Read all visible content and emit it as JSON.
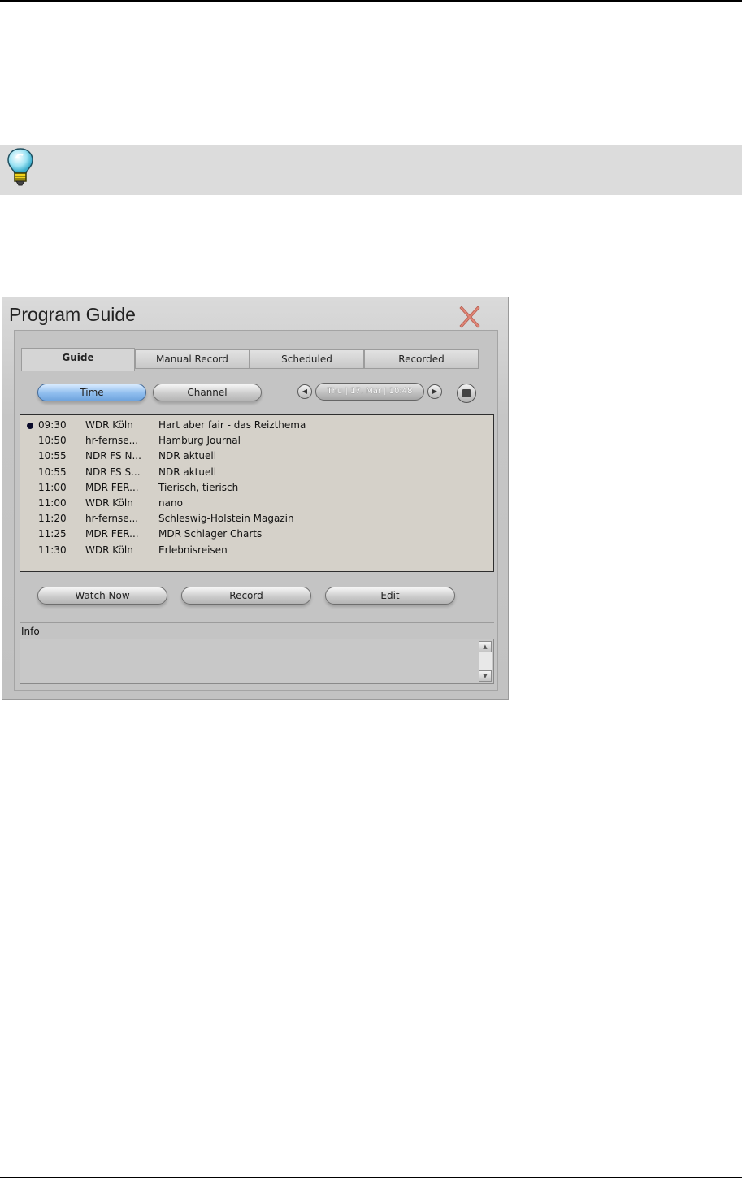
{
  "window": {
    "title": "Program Guide",
    "close_icon": "close-x-icon"
  },
  "tabs": [
    {
      "label": "Guide",
      "active": true
    },
    {
      "label": "Manual Record",
      "active": false
    },
    {
      "label": "Scheduled",
      "active": false
    },
    {
      "label": "Recorded",
      "active": false
    }
  ],
  "sort": {
    "time_label": "Time",
    "channel_label": "Channel",
    "selected": "Time"
  },
  "date": {
    "value": "Thu | 17. Mar | 10:48",
    "prev_icon": "left-arrow-icon",
    "next_icon": "right-arrow-icon",
    "calendar_icon": "calendar-icon"
  },
  "programs": [
    {
      "time": "09:30",
      "channel": "WDR Köln",
      "title": "Hart aber fair - das Reizthema",
      "current": true
    },
    {
      "time": "10:50",
      "channel": "hr-fernse...",
      "title": "Hamburg Journal",
      "current": false
    },
    {
      "time": "10:55",
      "channel": "NDR FS N...",
      "title": "NDR aktuell",
      "current": false
    },
    {
      "time": "10:55",
      "channel": "NDR FS S...",
      "title": "NDR aktuell",
      "current": false
    },
    {
      "time": "11:00",
      "channel": "MDR FER...",
      "title": "Tierisch, tierisch",
      "current": false
    },
    {
      "time": "11:00",
      "channel": "WDR Köln",
      "title": "nano",
      "current": false
    },
    {
      "time": "11:20",
      "channel": "hr-fernse...",
      "title": "Schleswig-Holstein Magazin",
      "current": false
    },
    {
      "time": "11:25",
      "channel": "MDR FER...",
      "title": "MDR Schlager Charts",
      "current": false
    },
    {
      "time": "11:30",
      "channel": "WDR Köln",
      "title": "Erlebnisreisen",
      "current": false
    }
  ],
  "actions": {
    "watch_now": "Watch Now",
    "record": "Record",
    "edit": "Edit"
  },
  "info": {
    "label": "Info"
  },
  "colors": {
    "selected_button": "#8fbdee",
    "list_background": "#d5d1c9",
    "tip_bar": "#dcdcdc"
  }
}
